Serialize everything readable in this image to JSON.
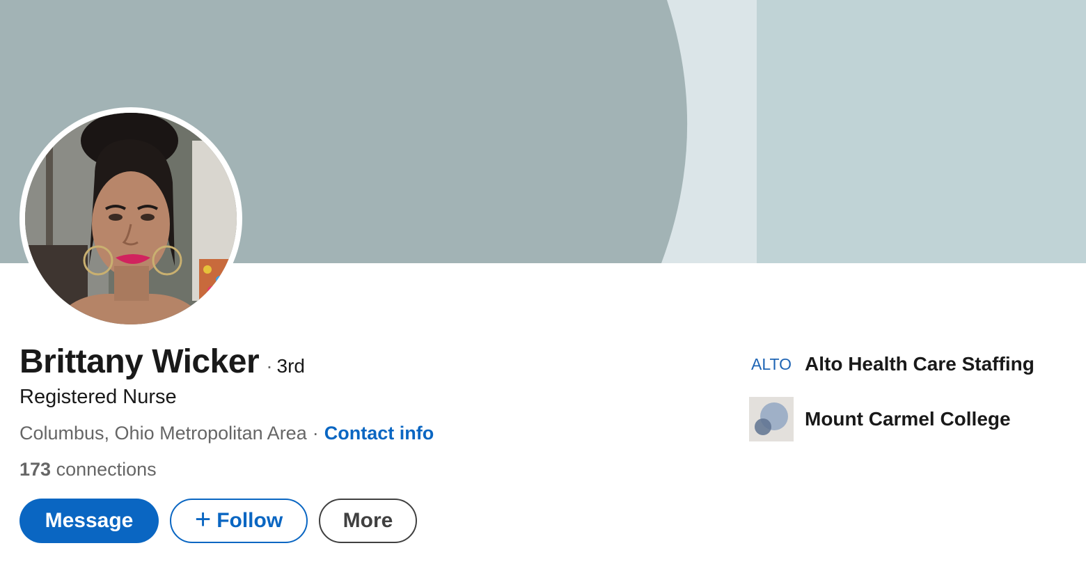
{
  "profile": {
    "name": "Brittany Wicker",
    "degree_separator": "·",
    "degree": "3rd",
    "headline": "Registered Nurse",
    "location": "Columbus, Ohio Metropolitan Area",
    "location_separator": "·",
    "contact_info_label": "Contact info",
    "connections_count": "173",
    "connections_label": "connections"
  },
  "actions": {
    "message_label": "Message",
    "follow_plus": "+",
    "follow_label": "Follow",
    "more_label": "More"
  },
  "organizations": [
    {
      "logo_text": "ALTO",
      "name": "Alto Health Care Staffing",
      "logo_icon": "alto-logo-icon"
    },
    {
      "name": "Mount Carmel College",
      "logo_icon": "overlapping-circles-logo-icon"
    }
  ],
  "colors": {
    "accent": "#0a66c2",
    "banner_main": "#a2b3b5",
    "banner_light": "#dbe5e8",
    "banner_right": "#c0d3d6",
    "text_primary": "#191919",
    "text_secondary": "#666666"
  }
}
